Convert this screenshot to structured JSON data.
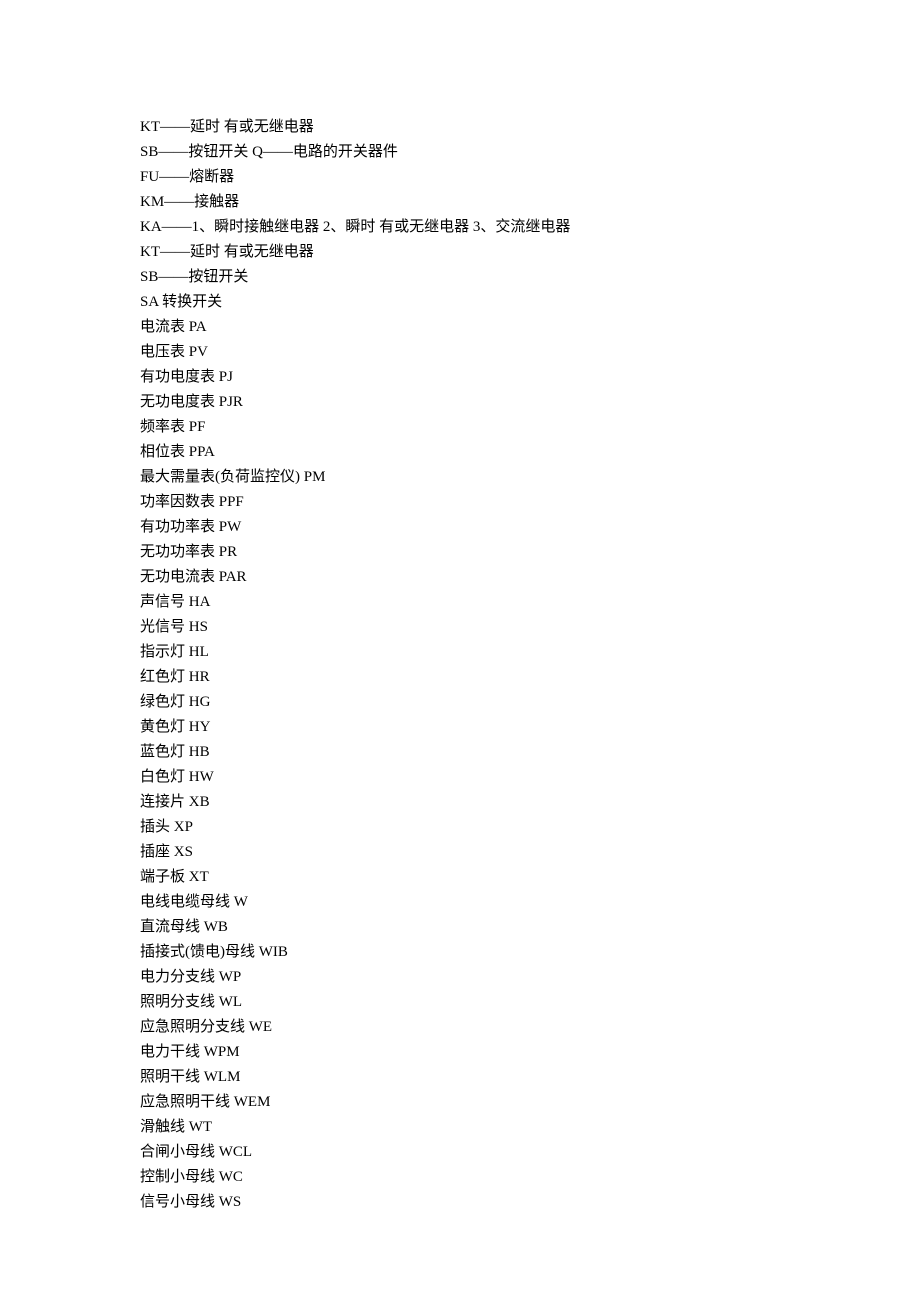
{
  "lines": [
    "KT——延时 有或无继电器",
    "SB——按钮开关 Q——电路的开关器件",
    "FU——熔断器",
    "KM——接触器",
    "KA——1、瞬时接触继电器 2、瞬时 有或无继电器 3、交流继电器",
    "KT——延时 有或无继电器",
    "SB——按钮开关",
    "SA 转换开关",
    "电流表 PA",
    "电压表 PV",
    "有功电度表 PJ",
    "无功电度表 PJR",
    "频率表 PF",
    "相位表 PPA",
    "最大需量表(负荷监控仪) PM",
    "功率因数表 PPF",
    "有功功率表 PW",
    "无功功率表 PR",
    "无功电流表 PAR",
    "声信号 HA",
    "光信号 HS",
    "指示灯 HL",
    "红色灯 HR",
    "绿色灯 HG",
    "黄色灯 HY",
    "蓝色灯 HB",
    "白色灯 HW",
    "连接片 XB",
    "插头 XP",
    "插座 XS",
    "端子板 XT",
    "电线电缆母线 W",
    "直流母线 WB",
    "插接式(馈电)母线 WIB",
    "电力分支线 WP",
    "照明分支线 WL",
    "应急照明分支线 WE",
    "电力干线 WPM",
    "照明干线 WLM",
    "应急照明干线 WEM",
    "滑触线 WT",
    "合闸小母线 WCL",
    "控制小母线 WC",
    "信号小母线 WS"
  ]
}
